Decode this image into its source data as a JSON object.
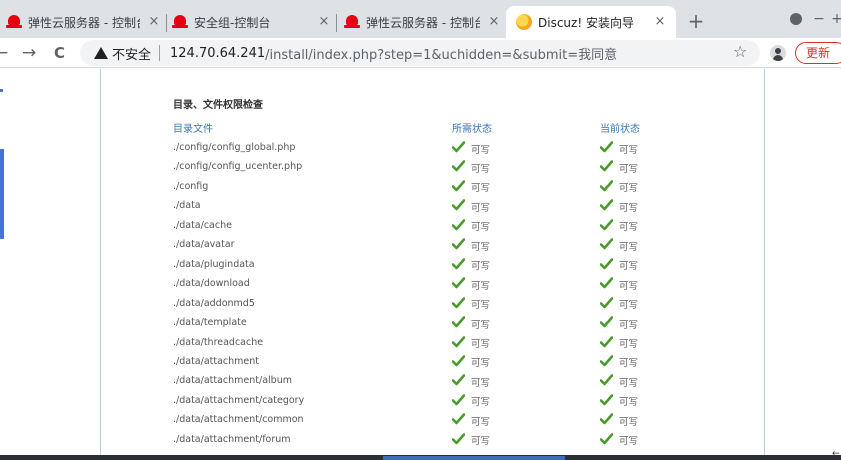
{
  "browser": {
    "tabs": [
      {
        "title": "弹性云服务器 - 控制台",
        "icon": "huawei-logo-icon",
        "active": false
      },
      {
        "title": "安全组-控制台",
        "icon": "huawei-logo-icon",
        "active": false
      },
      {
        "title": "弹性云服务器 - 控制台",
        "icon": "huawei-logo-icon",
        "active": false
      },
      {
        "title": "Discuz! 安装向导",
        "icon": "discuz-logo-icon",
        "active": true
      }
    ],
    "close_glyph": "×",
    "new_tab_glyph": "+",
    "minimize_glyph": "−",
    "maximize_glyph": "+",
    "toolbar": {
      "back_glyph": "←",
      "forward_glyph": "→",
      "reload_glyph": "C",
      "security_label": "不安全",
      "url_host": "124.70.64.241",
      "url_rest": "/install/index.php?step=1&uchidden=&submit=我同意",
      "bookmark_glyph": "☆",
      "update_label": "更新"
    }
  },
  "page": {
    "section_title": "目录、文件权限检查",
    "columns": {
      "path": "目录文件",
      "required": "所需状态",
      "current": "当前状态"
    },
    "rows": [
      {
        "path": "./config/config_global.php",
        "required": "可写",
        "current": "可写"
      },
      {
        "path": "./config/config_ucenter.php",
        "required": "可写",
        "current": "可写"
      },
      {
        "path": "./config",
        "required": "可写",
        "current": "可写"
      },
      {
        "path": "./data",
        "required": "可写",
        "current": "可写"
      },
      {
        "path": "./data/cache",
        "required": "可写",
        "current": "可写"
      },
      {
        "path": "./data/avatar",
        "required": "可写",
        "current": "可写"
      },
      {
        "path": "./data/plugindata",
        "required": "可写",
        "current": "可写"
      },
      {
        "path": "./data/download",
        "required": "可写",
        "current": "可写"
      },
      {
        "path": "./data/addonmd5",
        "required": "可写",
        "current": "可写"
      },
      {
        "path": "./data/template",
        "required": "可写",
        "current": "可写"
      },
      {
        "path": "./data/threadcache",
        "required": "可写",
        "current": "可写"
      },
      {
        "path": "./data/attachment",
        "required": "可写",
        "current": "可写"
      },
      {
        "path": "./data/attachment/album",
        "required": "可写",
        "current": "可写"
      },
      {
        "path": "./data/attachment/category",
        "required": "可写",
        "current": "可写"
      },
      {
        "path": "./data/attachment/common",
        "required": "可写",
        "current": "可写"
      },
      {
        "path": "./data/attachment/forum",
        "required": "可写",
        "current": "可写"
      }
    ],
    "status_icon": "check-icon",
    "colors": {
      "check": "#4a9a2c",
      "header_text": "#3776b5",
      "panel_border": "#b9cde0"
    }
  }
}
